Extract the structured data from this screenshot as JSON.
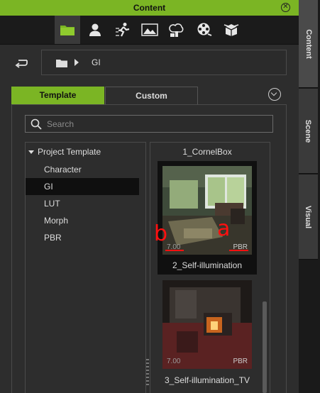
{
  "window": {
    "title": "Content"
  },
  "toolbar": {
    "buttons": [
      {
        "icon": "folder-icon",
        "active": true
      },
      {
        "icon": "person-icon"
      },
      {
        "icon": "motion-icon"
      },
      {
        "icon": "stage-icon"
      },
      {
        "icon": "prop-icon"
      },
      {
        "icon": "film-reel-icon"
      },
      {
        "icon": "package-icon"
      }
    ]
  },
  "breadcrumb": {
    "current": "GI"
  },
  "tabs": {
    "template": "Template",
    "custom": "Custom"
  },
  "search": {
    "placeholder": "Search"
  },
  "tree": {
    "root": "Project Template",
    "items": [
      "Character",
      "GI",
      "LUT",
      "Morph",
      "PBR"
    ],
    "selected": "GI"
  },
  "grid": {
    "items": [
      {
        "label": "1_CornelBox"
      },
      {
        "label": "2_Self-illumination",
        "badge": "PBR",
        "version": "7.00"
      },
      {
        "label": "3_Self-illumination_TV",
        "badge": "PBR",
        "version": "7.00"
      }
    ]
  },
  "annotations": {
    "a": "a",
    "b": "b"
  },
  "sidetabs": {
    "content": "Content",
    "scene": "Scene",
    "visual": "Visual"
  },
  "colors": {
    "accent": "#7bb524",
    "annotation": "#ff1010"
  }
}
